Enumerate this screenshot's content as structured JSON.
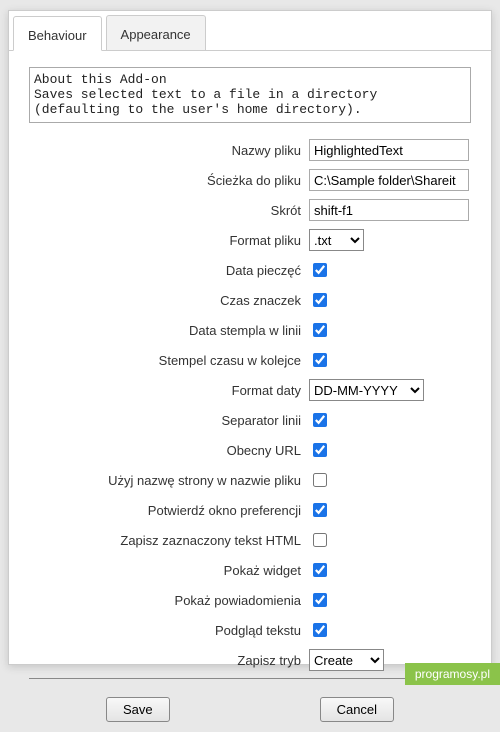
{
  "tabs": {
    "behaviour": "Behaviour",
    "appearance": "Appearance"
  },
  "about": "About this Add-on\nSaves selected text to a file in a directory (defaulting to the user's home directory).",
  "labels": {
    "filename": "Nazwy pliku",
    "filepath": "Ścieżka do pliku",
    "shortcut": "Skrót",
    "fileformat": "Format pliku",
    "datestamp": "Data pieczęć",
    "timestamp": "Czas znaczek",
    "datestamp_inline": "Data stempla w linii",
    "timestamp_queue": "Stempel czasu w kolejce",
    "dateformat": "Format daty",
    "lineseparator": "Separator linii",
    "currenturl": "Obecny URL",
    "pagename_in_filename": "Użyj nazwę strony w nazwie pliku",
    "confirm_pref": "Potwierdź okno preferencji",
    "save_html": "Zapisz zaznaczony tekst HTML",
    "show_widget": "Pokaż widget",
    "show_notifications": "Pokaż powiadomienia",
    "text_preview": "Podgląd tekstu",
    "save_mode": "Zapisz tryb"
  },
  "values": {
    "filename": "HighlightedText",
    "filepath": "C:\\Sample folder\\Shareit",
    "shortcut": "shift-f1",
    "fileformat": ".txt",
    "dateformat": "DD-MM-YYYY",
    "save_mode": "Create",
    "datestamp": true,
    "timestamp": true,
    "datestamp_inline": true,
    "timestamp_queue": true,
    "lineseparator": true,
    "currenturl": true,
    "pagename_in_filename": false,
    "confirm_pref": true,
    "save_html": false,
    "show_widget": true,
    "show_notifications": true,
    "text_preview": true
  },
  "buttons": {
    "save": "Save",
    "cancel": "Cancel"
  },
  "watermark": "programosy.pl"
}
